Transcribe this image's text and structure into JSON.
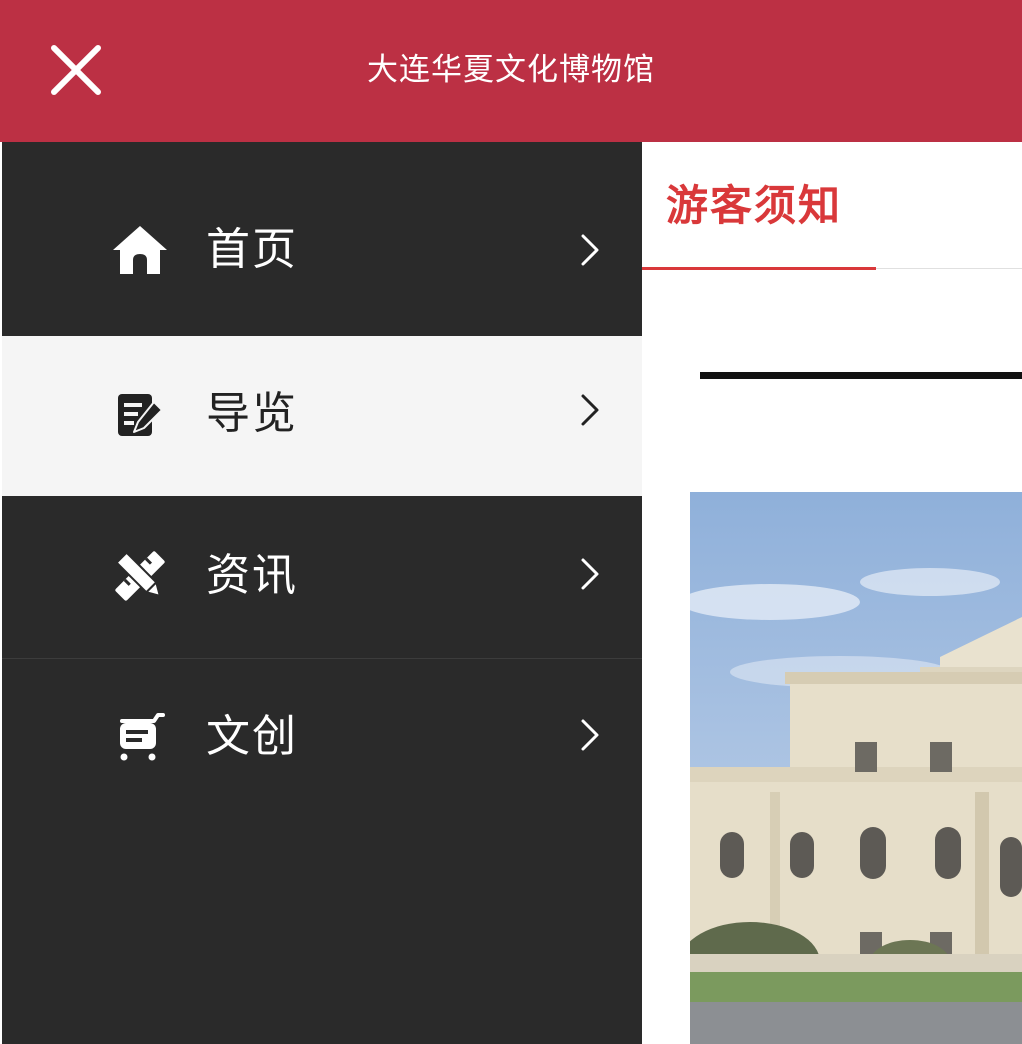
{
  "header": {
    "title": "大连华夏文化博物馆",
    "close_icon": "close-icon",
    "background_color": "#bc3044"
  },
  "sidebar": {
    "background_color": "#2a2a2a",
    "items": [
      {
        "label": "首页",
        "icon": "home-icon",
        "active": false
      },
      {
        "label": "导览",
        "icon": "edit-note-icon",
        "active": true
      },
      {
        "label": "资讯",
        "icon": "pencil-ruler-icon",
        "active": false
      },
      {
        "label": "文创",
        "icon": "shopping-cart-icon",
        "active": false
      }
    ]
  },
  "content": {
    "tab_label": "游客须知",
    "accent_color": "#d9383a",
    "image_subject": "museum-building-photo"
  }
}
